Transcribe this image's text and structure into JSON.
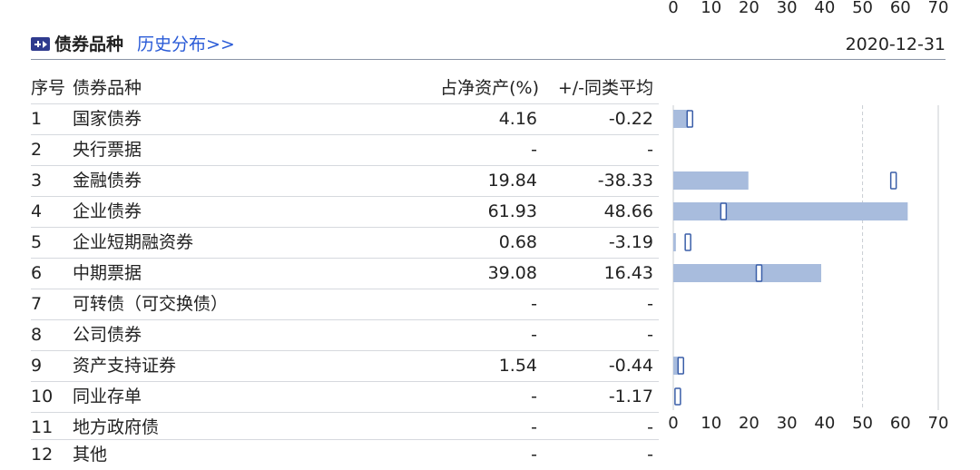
{
  "header": {
    "title": "债券品种",
    "history_link": "历史分布>>",
    "date": "2020-12-31"
  },
  "table": {
    "columns": [
      "序号",
      "债券品种",
      "占净资产(%)",
      "+/-同类平均"
    ],
    "rows": [
      {
        "idx": "1",
        "name": "国家债券",
        "pct": "4.16",
        "diff": "-0.22"
      },
      {
        "idx": "2",
        "name": "央行票据",
        "pct": "-",
        "diff": "-"
      },
      {
        "idx": "3",
        "name": "金融债券",
        "pct": "19.84",
        "diff": "-38.33"
      },
      {
        "idx": "4",
        "name": "企业债券",
        "pct": "61.93",
        "diff": "48.66"
      },
      {
        "idx": "5",
        "name": "企业短期融资券",
        "pct": "0.68",
        "diff": "-3.19"
      },
      {
        "idx": "6",
        "name": "中期票据",
        "pct": "39.08",
        "diff": "16.43"
      },
      {
        "idx": "7",
        "name": "可转债（可交换债）",
        "pct": "-",
        "diff": "-"
      },
      {
        "idx": "8",
        "name": "公司债券",
        "pct": "-",
        "diff": "-"
      },
      {
        "idx": "9",
        "name": "资产支持证券",
        "pct": "1.54",
        "diff": "-0.44"
      },
      {
        "idx": "10",
        "name": "同业存单",
        "pct": "-",
        "diff": "-1.17"
      },
      {
        "idx": "11",
        "name": "地方政府债",
        "pct": "-",
        "diff": "-"
      },
      {
        "idx": "12",
        "name": "其他",
        "pct": "-",
        "diff": "-"
      }
    ]
  },
  "chart_data": {
    "type": "bar",
    "orientation": "horizontal",
    "categories": [
      "国家债券",
      "央行票据",
      "金融债券",
      "企业债券",
      "企业短期融资券",
      "中期票据",
      "可转债（可交换债）",
      "公司债券",
      "资产支持证券",
      "同业存单"
    ],
    "series": [
      {
        "values": [
          4.16,
          null,
          19.84,
          61.93,
          0.68,
          39.08,
          null,
          null,
          1.54,
          null
        ]
      },
      {
        "values": [
          4.38,
          null,
          58.17,
          13.27,
          3.87,
          22.65,
          null,
          null,
          1.98,
          1.17
        ]
      }
    ],
    "xlim": [
      0,
      70
    ],
    "xticks": [
      "0",
      "10",
      "20",
      "30",
      "40",
      "50",
      "60",
      "70"
    ],
    "grid": true,
    "colors": {
      "bar_fill": "#a8bcdd",
      "marker_stroke": "#3a5ea8",
      "marker_fill": "#ffffff",
      "grid": "#c8ccd2"
    }
  }
}
